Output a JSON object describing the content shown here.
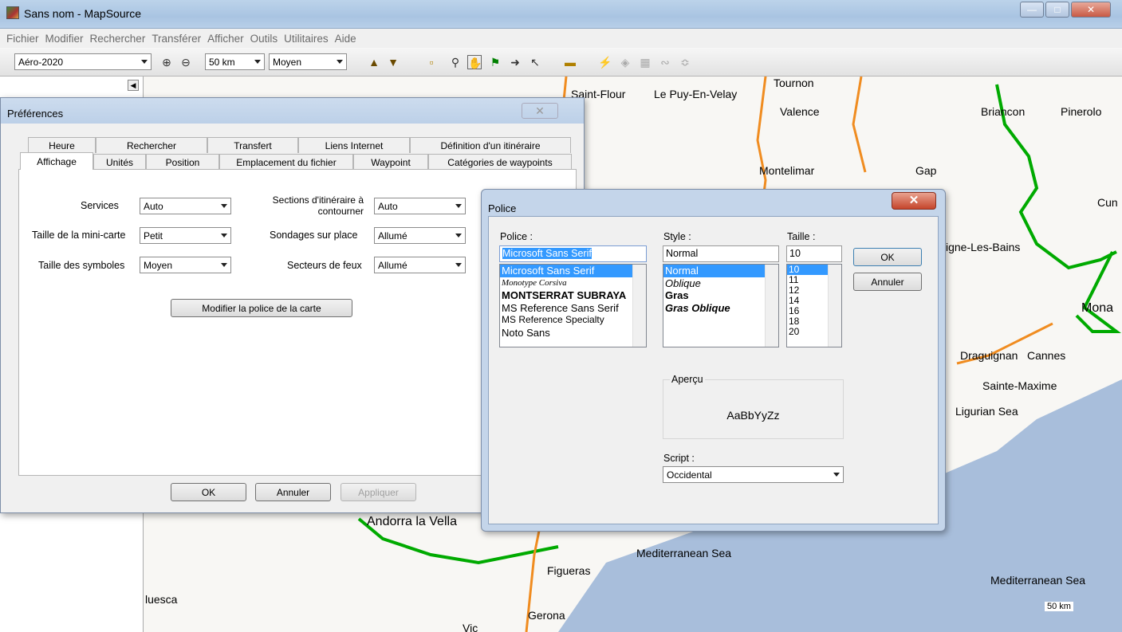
{
  "window": {
    "title": "Sans nom - MapSource"
  },
  "menu": [
    "Fichier",
    "Modifier",
    "Rechercher",
    "Transférer",
    "Afficher",
    "Outils",
    "Utilitaires",
    "Aide"
  ],
  "toolbar": {
    "map_product": "Aéro-2020",
    "zoom_level": "50 km",
    "detail": "Moyen"
  },
  "map": {
    "labels": {
      "saint_flour": "Saint-Flour",
      "le_puy": "Le Puy-En-Velay",
      "tournon": "Tournon",
      "valence": "Valence",
      "briancon": "Briancon",
      "pinerolo": "Pinerolo",
      "montelimar": "Montelimar",
      "gap": "Gap",
      "cun": "Cun",
      "digne": "igne-Les-Bains",
      "monaco": "Mona",
      "draguignan": "Draguignan",
      "cannes": "Cannes",
      "sainte_maxime": "Sainte-Maxime",
      "ligurian": "Ligurian Sea",
      "andorra": "Andorra la Vella",
      "med1": "Mediterranean Sea",
      "figueras": "Figueras",
      "med2": "Mediterranean Sea",
      "huesca": "luesca",
      "gerona": "Gerona",
      "vic": "Vic"
    },
    "scale_label": "50 km"
  },
  "preferences": {
    "title": "Préférences",
    "tabs_row1": [
      "Heure",
      "Rechercher",
      "Transfert",
      "Liens Internet",
      "Définition d'un itinéraire"
    ],
    "tabs_row2": [
      "Affichage",
      "Unités",
      "Position",
      "Emplacement du fichier",
      "Waypoint",
      "Catégories de waypoints"
    ],
    "fields": {
      "services_label": "Services",
      "services_value": "Auto",
      "minimap_label": "Taille de la mini-carte",
      "minimap_value": "Petit",
      "symbols_label": "Taille des symboles",
      "symbols_value": "Moyen",
      "sections_label_1": "Sections d'itinéraire à",
      "sections_label_2": "contourner",
      "sections_value": "Auto",
      "soundings_label": "Sondages sur place",
      "soundings_value": "Allumé",
      "lights_label": "Secteurs de feux",
      "lights_value": "Allumé"
    },
    "font_button": "Modifier la police de la carte",
    "ok": "OK",
    "cancel": "Annuler",
    "apply": "Appliquer"
  },
  "font_dialog": {
    "title": "Police",
    "font_label": "Police :",
    "font_value": "Microsoft Sans Serif",
    "fonts": [
      "Microsoft Sans Serif",
      "Monotype Corsiva",
      "MONTSERRAT SUBRAYA",
      "MS Reference Sans Serif",
      "MS Reference Specialty",
      "Noto Sans"
    ],
    "style_label": "Style :",
    "style_value": "Normal",
    "styles": [
      "Normal",
      "Oblique",
      "Gras",
      "Gras Oblique"
    ],
    "size_label": "Taille :",
    "size_value": "10",
    "sizes": [
      "10",
      "11",
      "12",
      "14",
      "16",
      "18",
      "20"
    ],
    "ok": "OK",
    "cancel": "Annuler",
    "preview_label": "Aperçu",
    "preview_text": "AaBbYyZz",
    "script_label": "Script :",
    "script_value": "Occidental"
  }
}
